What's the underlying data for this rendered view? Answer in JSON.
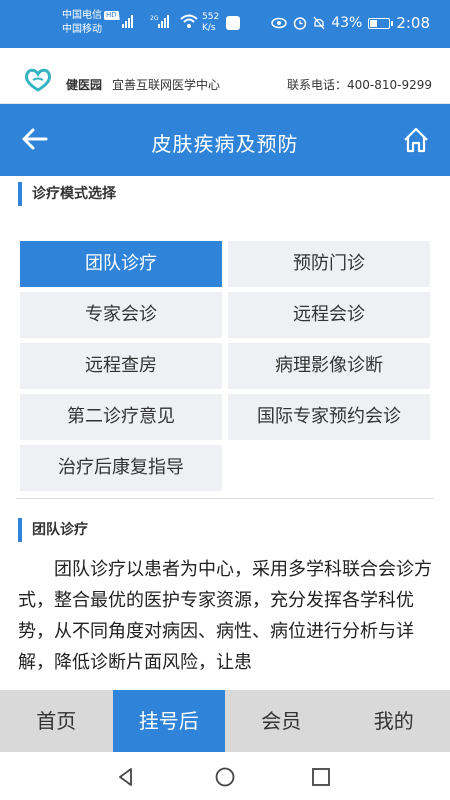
{
  "status_bar": {
    "carrier1": "中国电信",
    "hd": "HD",
    "carrier2": "中国移动",
    "signal1": "4G",
    "signal2": "2G",
    "net_speed_value": "552",
    "net_speed_unit": "K/s",
    "battery": "43%",
    "battery_level": 0.43,
    "time": "2:08"
  },
  "header": {
    "brand": "健医园",
    "slogan": "宜善互联网医学中心",
    "phone": "联系电话：400-810-9299"
  },
  "navbar": {
    "title": "皮肤疾病及预防"
  },
  "mode_section": {
    "title": "诊疗模式选择",
    "options": [
      {
        "label": "团队诊疗",
        "active": true
      },
      {
        "label": "预防门诊",
        "active": false
      },
      {
        "label": "专家会诊",
        "active": false
      },
      {
        "label": "远程会诊",
        "active": false
      },
      {
        "label": "远程查房",
        "active": false
      },
      {
        "label": "病理影像诊断",
        "active": false
      },
      {
        "label": "第二诊疗意见",
        "active": false
      },
      {
        "label": "国际专家预约会诊",
        "active": false
      },
      {
        "label": "治疗后康复指导",
        "active": false
      }
    ]
  },
  "detail_section": {
    "title": "团队诊疗",
    "text": "团队诊疗以患者为中心，采用多学科联合会诊方式，整合最优的医护专家资源，充分发挥各学科优势，从不同角度对病因、病性、病位进行分析与详解，降低诊断片面风险，让患"
  },
  "tabbar": {
    "tabs": [
      {
        "label": "首页",
        "active": false
      },
      {
        "label": "挂号后",
        "active": true
      },
      {
        "label": "会员",
        "active": false
      },
      {
        "label": "我的",
        "active": false
      }
    ]
  },
  "colors": {
    "primary": "#2f83d8",
    "option_bg": "#eef0f3",
    "tabbar_bg": "#d9d9d9"
  }
}
